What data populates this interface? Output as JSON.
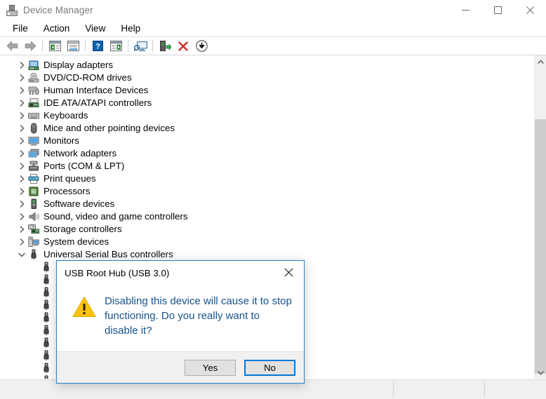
{
  "window": {
    "title": "Device Manager",
    "app_icon": "device-manager-icon",
    "minimize_label": "Minimize",
    "maximize_label": "Maximize",
    "close_label": "Close"
  },
  "menubar": {
    "items": [
      {
        "label": "File"
      },
      {
        "label": "Action"
      },
      {
        "label": "View"
      },
      {
        "label": "Help"
      }
    ]
  },
  "toolbar": {
    "buttons": [
      {
        "name": "back-button",
        "icon": "left-arrow-icon",
        "label": "Back"
      },
      {
        "name": "forward-button",
        "icon": "right-arrow-icon",
        "label": "Forward"
      },
      {
        "name": "separator-1",
        "icon": "separator",
        "label": ""
      },
      {
        "name": "show-hide-console-tree-button",
        "icon": "console-tree-icon",
        "label": "Show/Hide Console Tree"
      },
      {
        "name": "properties-button",
        "icon": "properties-icon",
        "label": "Properties"
      },
      {
        "name": "separator-2",
        "icon": "separator",
        "label": ""
      },
      {
        "name": "help-button",
        "icon": "help-question-icon",
        "label": "Help"
      },
      {
        "name": "show-hide-action-pane-button",
        "icon": "action-pane-icon",
        "label": "Show/Hide Action Pane"
      },
      {
        "name": "separator-3",
        "icon": "separator",
        "label": ""
      },
      {
        "name": "scan-for-hardware-changes-button",
        "icon": "scan-monitor-icon",
        "label": "Scan for hardware changes"
      },
      {
        "name": "separator-4",
        "icon": "separator",
        "label": ""
      },
      {
        "name": "update-driver-button",
        "icon": "update-driver-icon",
        "label": "Update driver"
      },
      {
        "name": "uninstall-device-button",
        "icon": "red-x-icon",
        "label": "Uninstall device"
      },
      {
        "name": "disable-device-button",
        "icon": "disable-arrow-icon",
        "label": "Disable device"
      }
    ]
  },
  "tree": {
    "items": [
      {
        "label": "Display adapters",
        "icon": "display-adapter-icon",
        "expanded": false
      },
      {
        "label": "DVD/CD-ROM drives",
        "icon": "dvd-drive-icon",
        "expanded": false
      },
      {
        "label": "Human Interface Devices",
        "icon": "hid-icon",
        "expanded": false
      },
      {
        "label": "IDE ATA/ATAPI controllers",
        "icon": "ide-controller-icon",
        "expanded": false
      },
      {
        "label": "Keyboards",
        "icon": "keyboard-icon",
        "expanded": false
      },
      {
        "label": "Mice and other pointing devices",
        "icon": "mouse-icon",
        "expanded": false
      },
      {
        "label": "Monitors",
        "icon": "monitor-icon",
        "expanded": false
      },
      {
        "label": "Network adapters",
        "icon": "network-adapter-icon",
        "expanded": false
      },
      {
        "label": "Ports (COM & LPT)",
        "icon": "port-icon",
        "expanded": false
      },
      {
        "label": "Print queues",
        "icon": "printer-icon",
        "expanded": false
      },
      {
        "label": "Processors",
        "icon": "processor-icon",
        "expanded": false
      },
      {
        "label": "Software devices",
        "icon": "software-device-icon",
        "expanded": false
      },
      {
        "label": "Sound, video and game controllers",
        "icon": "sound-icon",
        "expanded": false
      },
      {
        "label": "Storage controllers",
        "icon": "storage-controller-icon",
        "expanded": false
      },
      {
        "label": "System devices",
        "icon": "system-device-icon",
        "expanded": false
      },
      {
        "label": "Universal Serial Bus controllers",
        "icon": "usb-controller-icon",
        "expanded": true
      }
    ],
    "usb_children_count": 10,
    "usb_child_icon": "usb-plug-icon"
  },
  "scrollbar": {
    "up_arrow": "chevron-up-icon",
    "down_arrow": "chevron-down-icon"
  },
  "statusbar": {
    "text": ""
  },
  "dialog": {
    "title": "USB Root Hub (USB 3.0)",
    "close_label": "Close",
    "icon": "warning-triangle-icon",
    "message": "Disabling this device will cause it to stop functioning. Do you really want to disable it?",
    "buttons": [
      {
        "label": "Yes",
        "name": "yes-button",
        "default": false
      },
      {
        "label": "No",
        "name": "no-button",
        "default": true
      }
    ]
  },
  "colors": {
    "dialog_border": "#2a7fc4",
    "dialog_text": "#16538c",
    "default_button_border": "#0078d7",
    "warning_yellow": "#ffc20e",
    "uninstall_red": "#d42b26"
  }
}
